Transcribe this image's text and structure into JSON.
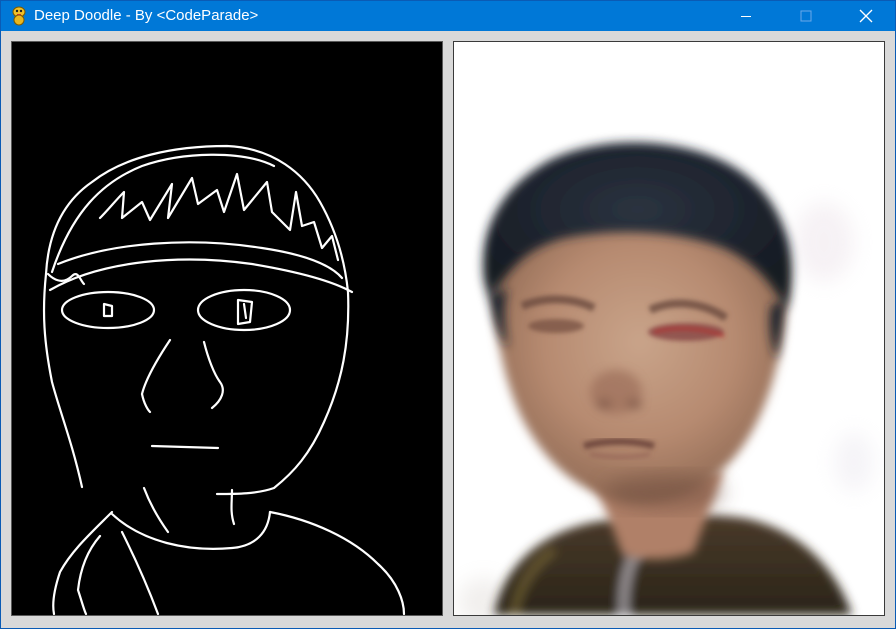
{
  "window": {
    "title": "Deep Doodle - By <CodeParade>",
    "accent_color": "#0078d7",
    "app_icon": "python-snake-icon",
    "controls": {
      "minimize_icon": "minimize-icon",
      "maximize_icon": "maximize-icon",
      "close_icon": "close-icon"
    }
  },
  "canvas": {
    "left_panel": {
      "content": "doodle-canvas",
      "background_color": "#000000",
      "stroke_color": "#ffffff"
    },
    "right_panel": {
      "content": "generated-face-output",
      "background_color": "#ffffff"
    }
  }
}
